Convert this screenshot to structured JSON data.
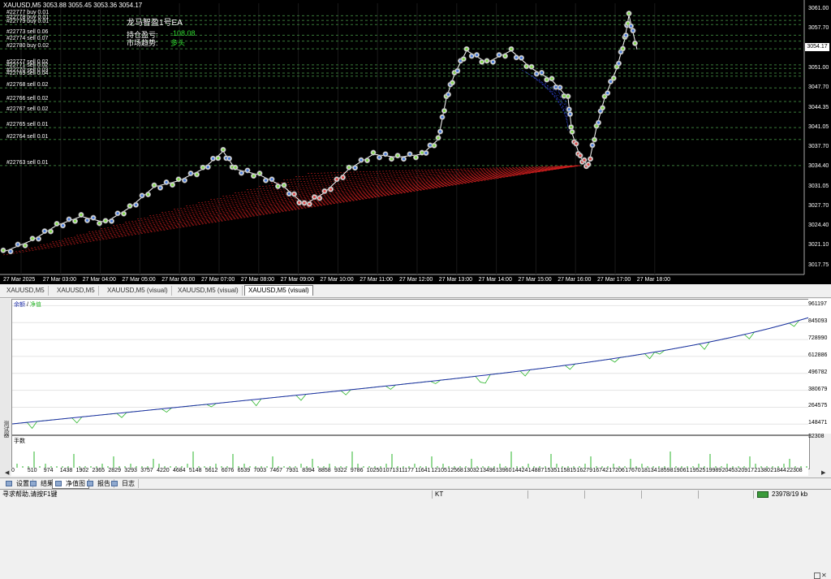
{
  "chart": {
    "symbol_info": "XAUUSD,M5  3053.88 3055.45 3053.36 3054.17",
    "ea_name": "龙马智盈1号EA",
    "position_pl_label": "持仓盈亏:",
    "position_pl_value": "-108.08",
    "trend_label": "市场趋势:",
    "trend_value": "多头",
    "current_price": "3054.17",
    "orders": [
      {
        "label": "#22777 buy 0.01",
        "price": 3059.9
      },
      {
        "label": "#22778 buy 0.01",
        "price": 3059.1
      },
      {
        "label": "#22779 buy 0.01",
        "price": 3058.4
      },
      {
        "label": "#22773 sell 0.06",
        "price": 3056.6
      },
      {
        "label": "#22774 sell 0.07",
        "price": 3055.6
      },
      {
        "label": "#22780 buy 0.02",
        "price": 3054.3
      },
      {
        "label": "#22777 sell 0.02",
        "price": 3051.6
      },
      {
        "label": "#22771 sell 0.02",
        "price": 3051.0
      },
      {
        "label": "#22770 sell 0.03",
        "price": 3050.2
      },
      {
        "label": "#22769 sell 0.04",
        "price": 3049.7
      },
      {
        "label": "#22768 sell 0.02",
        "price": 3047.7
      },
      {
        "label": "#22766 sell 0.02",
        "price": 3045.4
      },
      {
        "label": "#22767 sell 0.02",
        "price": 3043.6
      },
      {
        "label": "#22765 sell 0.01",
        "price": 3041.0
      },
      {
        "label": "#22764 sell 0.01",
        "price": 3039.0
      },
      {
        "label": "#22763 sell 0.01",
        "price": 3034.6
      }
    ],
    "price_ticks": [
      "3061.00",
      "3057.70",
      "3054.17",
      "3051.00",
      "3047.70",
      "3044.35",
      "3041.05",
      "3037.70",
      "3034.40",
      "3031.05",
      "3027.70",
      "3024.40",
      "3021.10",
      "3017.75"
    ],
    "time_ticks": [
      "27 Mar 2025",
      "27 Mar 03:00",
      "27 Mar 04:00",
      "27 Mar 05:00",
      "27 Mar 06:00",
      "27 Mar 07:00",
      "27 Mar 08:00",
      "27 Mar 09:00",
      "27 Mar 10:00",
      "27 Mar 11:00",
      "27 Mar 12:00",
      "27 Mar 13:00",
      "27 Mar 14:00",
      "27 Mar 15:00",
      "27 Mar 16:00",
      "27 Mar 17:00",
      "27 Mar 18:00"
    ],
    "colors": {
      "bg": "#000000",
      "buy_line": "#3a6f3a",
      "sell_line": "#3a6f3a",
      "price_line": "#ffffff",
      "marker_blue": "#4a7bd8",
      "marker_red": "#d84a4a",
      "marker_green": "#7fd84a",
      "trade_red": "#c81e1e",
      "trade_blue": "#2b3fc8"
    }
  },
  "chart_tabs": [
    {
      "label": "XAUUSD,M5",
      "active": false
    },
    {
      "label": "XAUUSD,M5",
      "active": false
    },
    {
      "label": "XAUUSD,M5 (visual)",
      "active": false
    },
    {
      "label": "XAUUSD,M5 (visual)",
      "active": false
    },
    {
      "label": "XAUUSD,M5 (visual)",
      "active": true
    }
  ],
  "equity": {
    "legend_balance": "余额",
    "legend_sep": " / ",
    "legend_equity": "净值",
    "volume_title": "手数",
    "volume_max": "32308",
    "y_ticks": [
      "961197",
      "845093",
      "728990",
      "612886",
      "496782",
      "380679",
      "264575",
      "148471"
    ],
    "x_ticks": [
      "0",
      "510",
      "974",
      "1438",
      "1902",
      "2365",
      "2829",
      "3293",
      "3757",
      "4220",
      "4684",
      "5148",
      "5612",
      "6076",
      "6539",
      "7003",
      "7467",
      "7931",
      "8394",
      "8858",
      "9322",
      "9786",
      "10250",
      "10713",
      "11177",
      "11641",
      "12105",
      "12568",
      "13032",
      "13496",
      "13960",
      "14424",
      "14887",
      "15351",
      "15815",
      "16279",
      "16742",
      "17206",
      "17670",
      "18134",
      "18598",
      "19061",
      "19525",
      "19989",
      "20453",
      "20917",
      "21380",
      "21844",
      "22308"
    ],
    "colors": {
      "balance": "#1f2fa8",
      "equity": "#2bb52b"
    }
  },
  "bottom_tabs": [
    {
      "label": "设置",
      "active": false
    },
    {
      "label": "结果",
      "active": false
    },
    {
      "label": "净值图",
      "active": true
    },
    {
      "label": "报告",
      "active": false
    },
    {
      "label": "日志",
      "active": false
    }
  ],
  "side_label": "测试器",
  "status": {
    "help": "寻求帮助,请按F1键",
    "profile": "KT",
    "traffic": "23978/19 kb"
  }
}
